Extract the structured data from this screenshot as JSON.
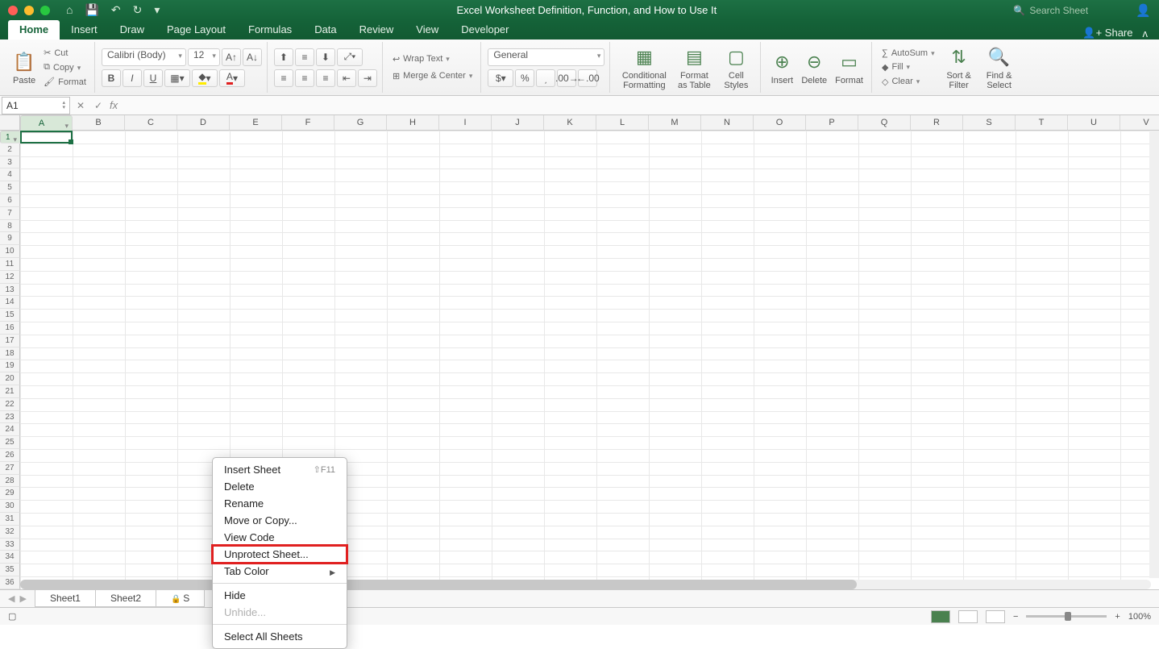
{
  "title": "Excel Worksheet Definition, Function, and How to Use It",
  "search_placeholder": "Search Sheet",
  "tabs": [
    "Home",
    "Insert",
    "Draw",
    "Page Layout",
    "Formulas",
    "Data",
    "Review",
    "View",
    "Developer"
  ],
  "active_tab": 0,
  "share_label": "Share",
  "ribbon": {
    "paste": "Paste",
    "cut": "Cut",
    "copy": "Copy",
    "format_painter": "Format",
    "font_name": "Calibri (Body)",
    "font_size": "12",
    "wrap": "Wrap Text",
    "merge": "Merge & Center",
    "number_format": "General",
    "cond_fmt": "Conditional Formatting",
    "fmt_table": "Format as Table",
    "cell_styles": "Cell Styles",
    "insert": "Insert",
    "delete": "Delete",
    "format": "Format",
    "autosum": "AutoSum",
    "fill": "Fill",
    "clear": "Clear",
    "sort": "Sort & Filter",
    "find": "Find & Select"
  },
  "namebox": "A1",
  "columns": [
    "A",
    "B",
    "C",
    "D",
    "E",
    "F",
    "G",
    "H",
    "I",
    "J",
    "K",
    "L",
    "M",
    "N",
    "O",
    "P",
    "Q",
    "R",
    "S",
    "T",
    "U",
    "V"
  ],
  "row_count": 36,
  "sheets": [
    {
      "name": "Sheet1",
      "locked": false
    },
    {
      "name": "Sheet2",
      "locked": false
    },
    {
      "name": "S",
      "locked": true
    }
  ],
  "context_menu": {
    "items": [
      {
        "label": "Insert Sheet",
        "shortcut": "⇧F11"
      },
      {
        "label": "Delete"
      },
      {
        "label": "Rename"
      },
      {
        "label": "Move or Copy..."
      },
      {
        "label": "View Code"
      },
      {
        "label": "Unprotect Sheet...",
        "highlight": true
      },
      {
        "label": "Tab Color",
        "submenu": true
      },
      {
        "sep": true
      },
      {
        "label": "Hide"
      },
      {
        "label": "Unhide...",
        "disabled": true
      },
      {
        "sep": true
      },
      {
        "label": "Select All Sheets"
      }
    ]
  },
  "zoom": "100%"
}
